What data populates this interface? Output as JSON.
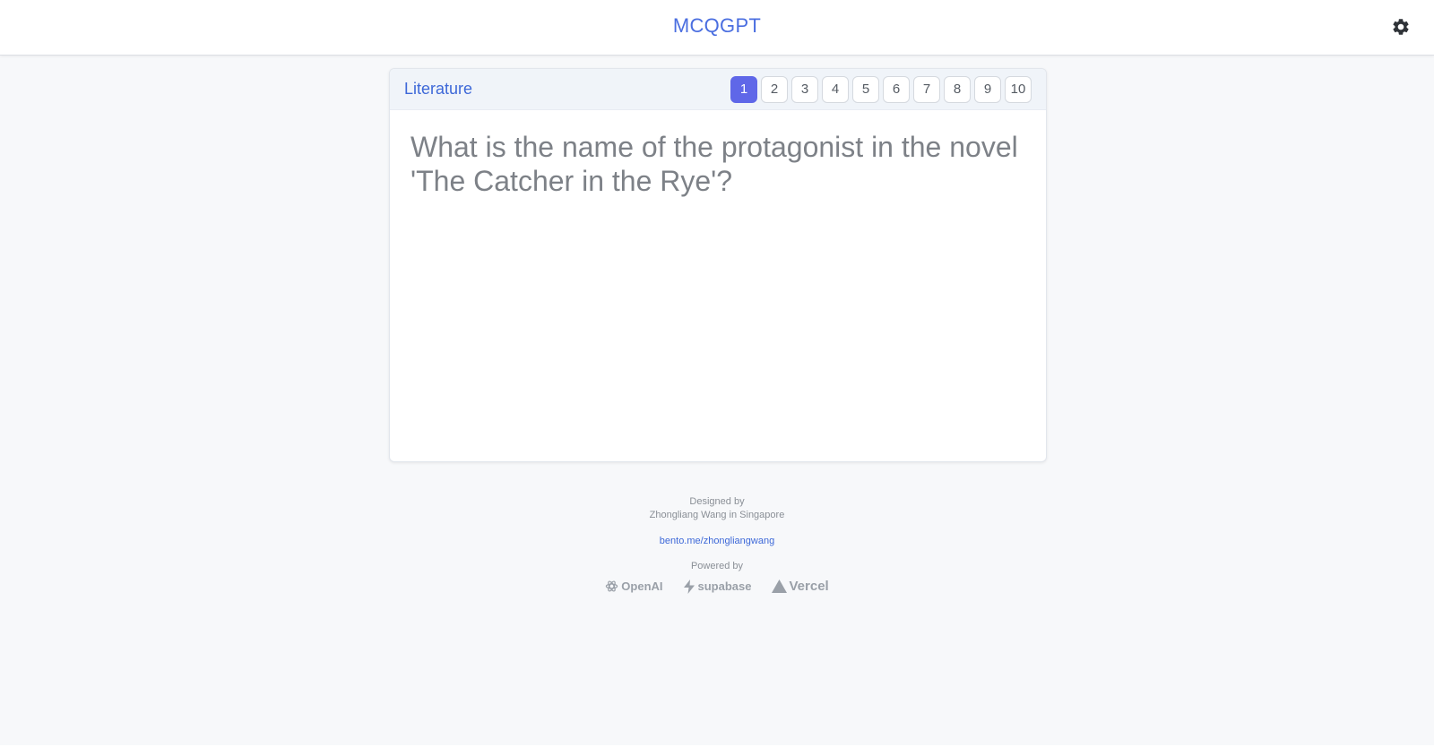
{
  "header": {
    "brand": "MCQGPT",
    "settings_icon": "gear-icon"
  },
  "card": {
    "category": "Literature",
    "pages": [
      "1",
      "2",
      "3",
      "4",
      "5",
      "6",
      "7",
      "8",
      "9",
      "10"
    ],
    "current_page": "1",
    "question": "What is the name of the protagonist in the novel 'The Catcher in the Rye'?"
  },
  "footer": {
    "designed_by": "Designed by",
    "author_line": "Zhongliang Wang in Singapore",
    "link_text": "bento.me/zhongliangwang",
    "powered_by": "Powered by",
    "logos": {
      "openai": "OpenAI",
      "supabase": "supabase",
      "vercel": "Vercel"
    }
  },
  "colors": {
    "accent": "#4a6ee0",
    "active_page": "#5f67e8",
    "background": "#f7f8fa",
    "question_text": "#7d8187"
  }
}
